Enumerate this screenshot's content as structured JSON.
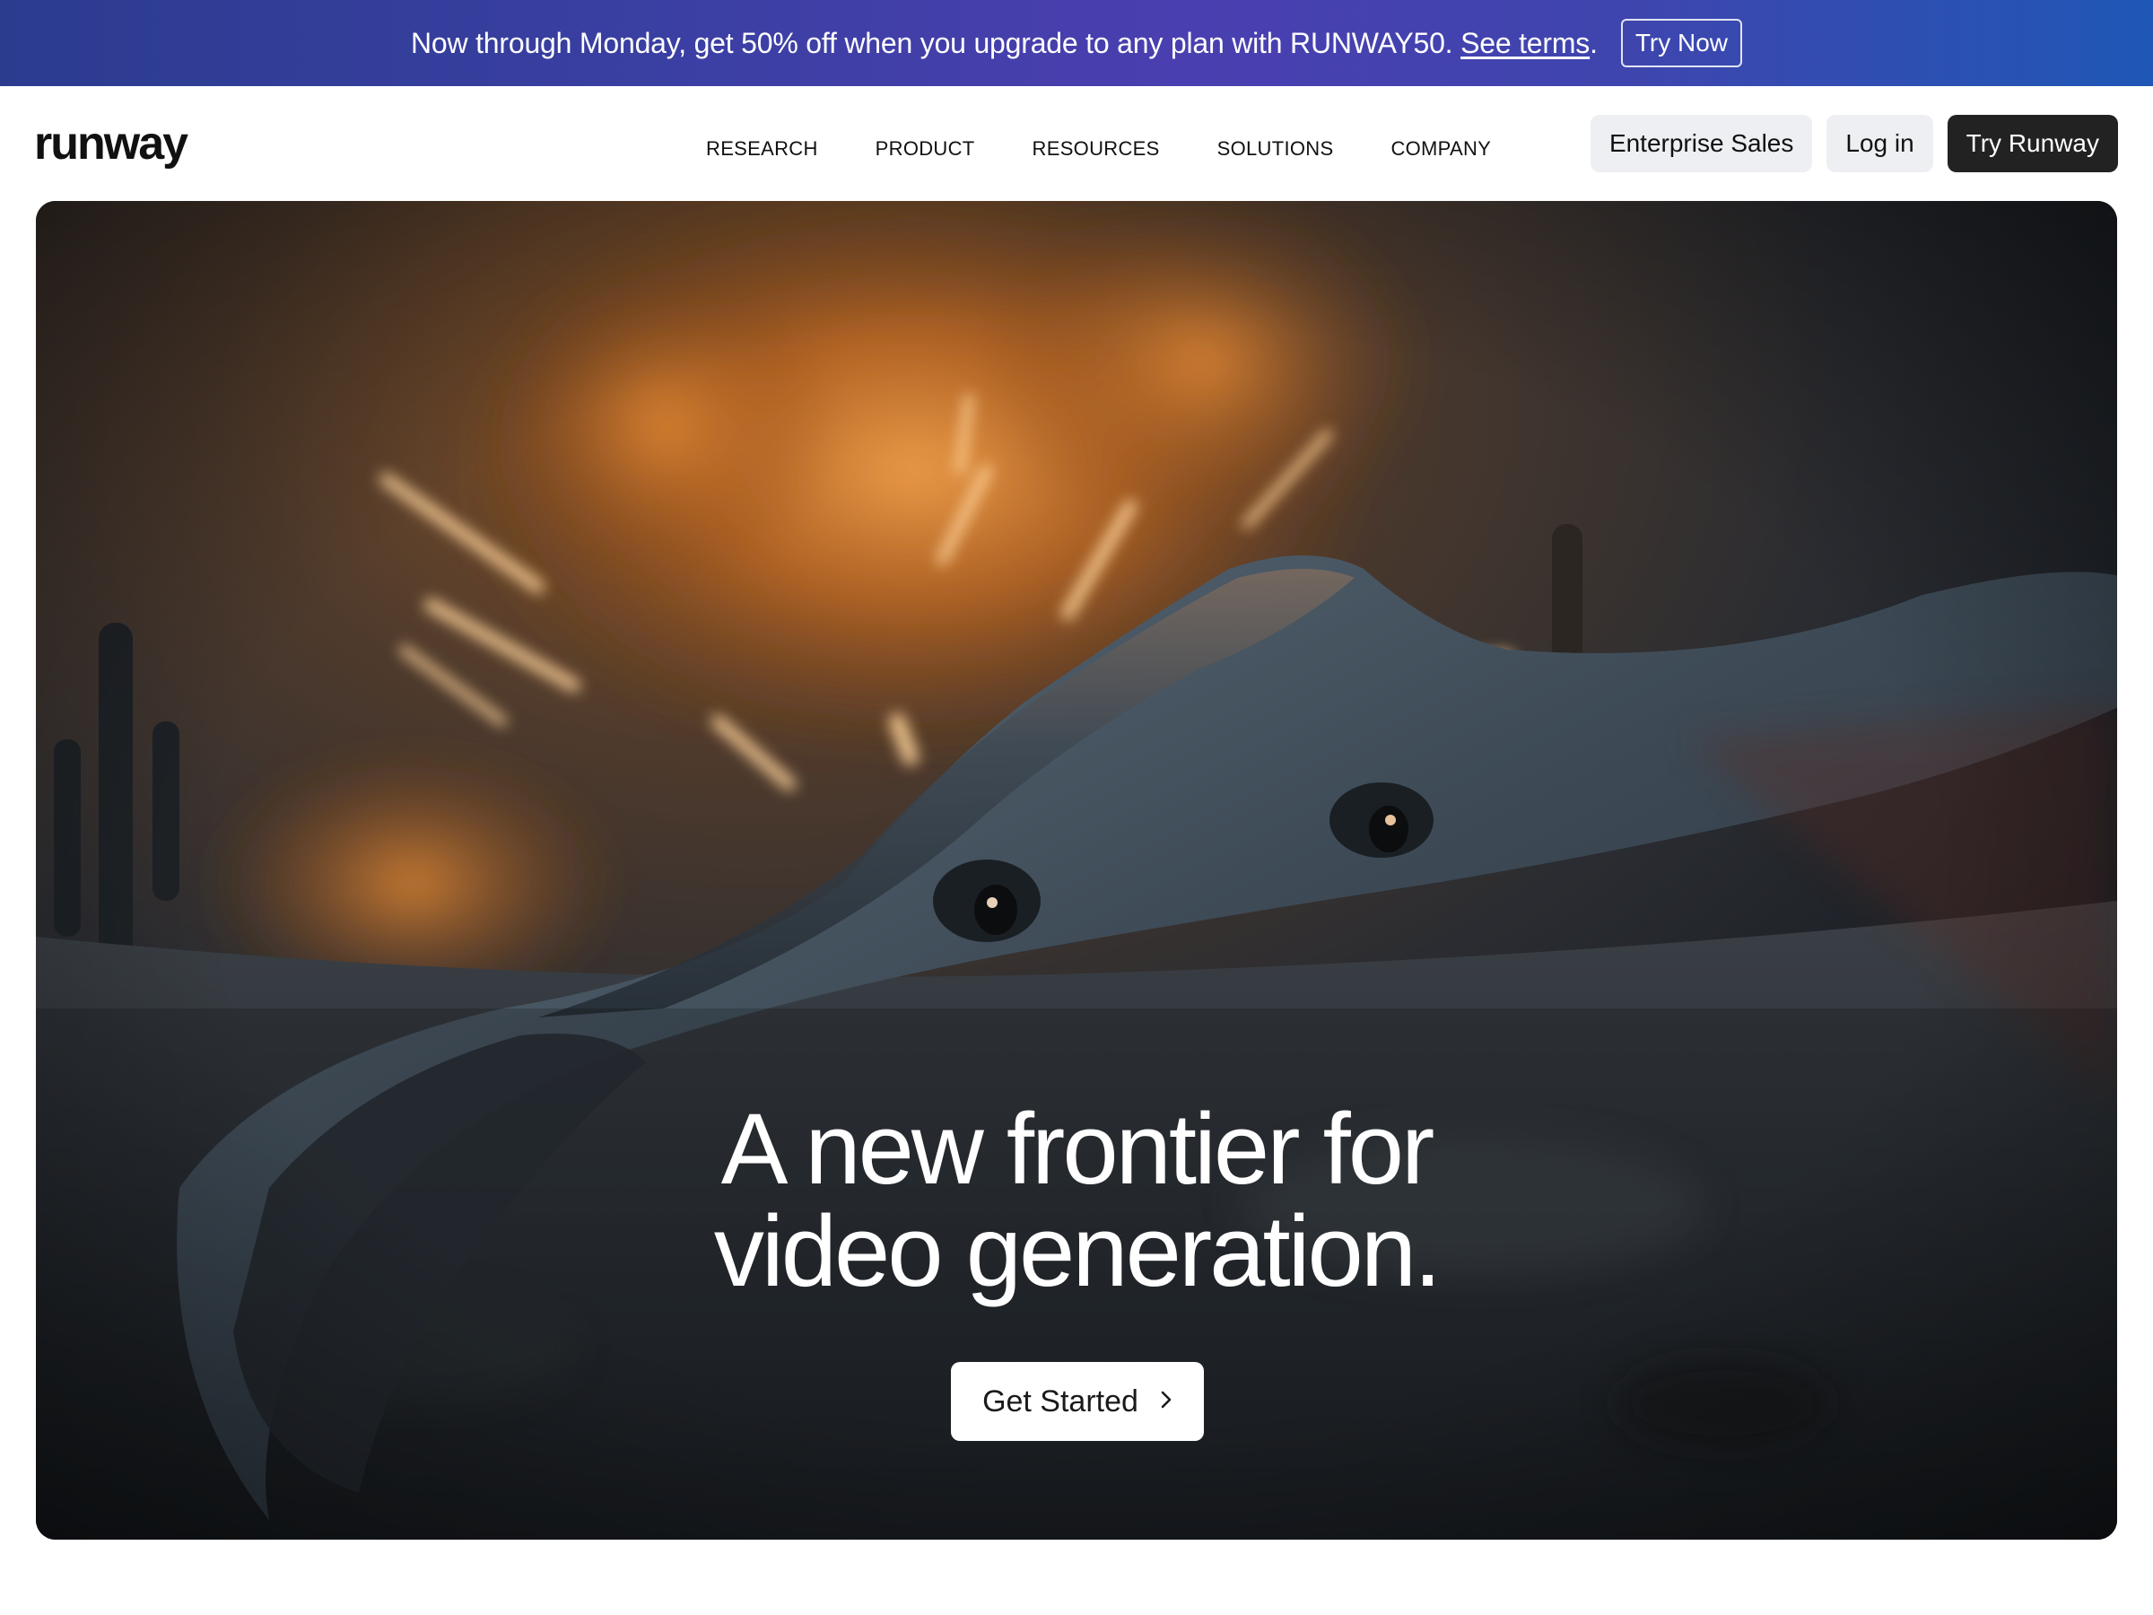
{
  "promo": {
    "text": "Now through Monday, get 50% off when you upgrade to any plan with RUNWAY50. ",
    "link": "See terms",
    "suffix": ".",
    "button": "Try Now"
  },
  "header": {
    "logo": "runway",
    "nav": [
      "RESEARCH",
      "PRODUCT",
      "RESOURCES",
      "SOLUTIONS",
      "COMPANY"
    ],
    "enterprise": "Enterprise Sales",
    "login": "Log in",
    "try": "Try Runway"
  },
  "hero": {
    "headline_line1": "A new frontier for",
    "headline_line2": "video generation.",
    "cta": "Get Started",
    "cta_icon": "chevron-right-icon"
  }
}
